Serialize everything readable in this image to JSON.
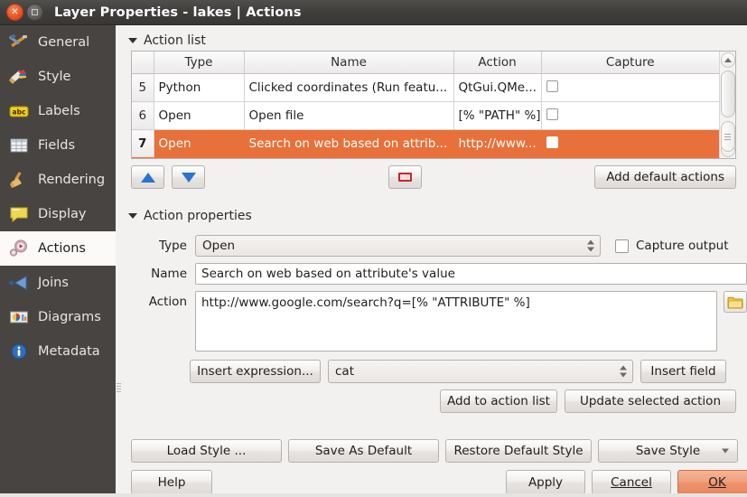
{
  "window": {
    "title": "Layer Properties - lakes | Actions",
    "close_icon": "close-icon",
    "maximize_icon": "maximize-icon"
  },
  "sidebar": {
    "items": [
      {
        "label": "General",
        "icon": "hammer-wrench-icon",
        "selected": false
      },
      {
        "label": "Style",
        "icon": "paintbrush-icon",
        "selected": false
      },
      {
        "label": "Labels",
        "icon": "abc-label-icon",
        "selected": false
      },
      {
        "label": "Fields",
        "icon": "table-grid-icon",
        "selected": false
      },
      {
        "label": "Rendering",
        "icon": "broom-icon",
        "selected": false
      },
      {
        "label": "Display",
        "icon": "speech-bubble-icon",
        "selected": false
      },
      {
        "label": "Actions",
        "icon": "gear-play-icon",
        "selected": true
      },
      {
        "label": "Joins",
        "icon": "join-arrow-icon",
        "selected": false
      },
      {
        "label": "Diagrams",
        "icon": "pie-chart-icon",
        "selected": false
      },
      {
        "label": "Metadata",
        "icon": "info-circle-icon",
        "selected": false
      }
    ]
  },
  "action_list": {
    "group_title": "Action list",
    "collapse_icon": "triangle-down-icon",
    "columns": [
      "",
      "Type",
      "Name",
      "Action",
      "Capture"
    ],
    "rows": [
      {
        "num": "5",
        "type": "Python",
        "name": "Clicked coordinates (Run featu...",
        "action": "QtGui.QMe...",
        "capture": false,
        "selected": false
      },
      {
        "num": "6",
        "type": "Open",
        "name": "Open file",
        "action": "[% \"PATH\" %]",
        "capture": false,
        "selected": false
      },
      {
        "num": "7",
        "type": "Open",
        "name": "Search on web based on attrib...",
        "action": "http://www...",
        "capture": false,
        "selected": true
      }
    ],
    "scrollbar": {
      "up_icon": "scroll-up-arrow-icon",
      "down_icon": "scroll-down-arrow-icon"
    }
  },
  "toolbar": {
    "move_up_icon": "arrow-up-icon",
    "move_down_icon": "arrow-down-icon",
    "remove_icon": "remove-icon",
    "add_default_label": "Add default actions"
  },
  "action_properties": {
    "group_title": "Action properties",
    "collapse_icon": "triangle-down-icon",
    "type_label": "Type",
    "type_value": "Open",
    "capture_output_label": "Capture output",
    "capture_output_checked": false,
    "name_label": "Name",
    "name_value": "Search on web based on attribute's value",
    "action_label": "Action",
    "action_value": "http://www.google.com/search?q=[% \"ATTRIBUTE\" %]",
    "browse_icon": "folder-icon",
    "insert_expression_label": "Insert expression...",
    "field_value": "cat",
    "insert_field_label": "Insert field",
    "add_to_action_list_label": "Add to action list",
    "update_selected_action_label": "Update selected action"
  },
  "style_buttons": {
    "load_style": "Load Style ...",
    "save_as_default": "Save As Default",
    "restore_default_style": "Restore Default Style",
    "save_style": "Save Style",
    "save_style_menu_icon": "chevron-down-icon"
  },
  "dialog_buttons": {
    "help": "Help",
    "apply": "Apply",
    "cancel": "Cancel",
    "ok": "OK"
  },
  "colors": {
    "selection_orange": "#e8703a",
    "ok_button": "#f0a07c",
    "titlebar": "#413f3d",
    "sidebar": "#474441",
    "panel": "#f2f1f0"
  }
}
